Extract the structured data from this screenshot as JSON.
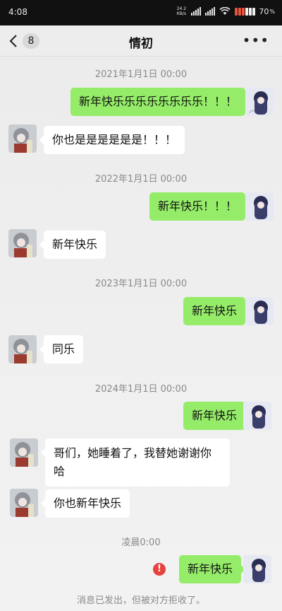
{
  "status": {
    "time": "4:08",
    "net_speed_value": "24.2",
    "net_speed_unit": "KB/s",
    "battery": "70"
  },
  "header": {
    "title": "情初",
    "unread_count": "8"
  },
  "messages": [
    {
      "timestamp": "2021年1月1日 00:00",
      "sent": "新年快乐乐乐乐乐乐乐乐！！！",
      "received": "你也是是是是是是！！！"
    },
    {
      "timestamp": "2022年1月1日 00:00",
      "sent": "新年快乐！！！",
      "received": "新年快乐"
    },
    {
      "timestamp": "2023年1月1日 00:00",
      "sent": "新年快乐",
      "received": "同乐"
    },
    {
      "timestamp": "2024年1月1日 00:00",
      "sent": "新年快乐",
      "received": "哥们，她睡着了，我替她谢谢你哈",
      "received2": "你也新年快乐"
    },
    {
      "timestamp": "凌晨0:00",
      "sent": "新年快乐"
    }
  ],
  "rejected_notice": "消息已发出，但被对方拒收了。",
  "colors": {
    "sent_bubble": "#95ec69",
    "error": "#e64340"
  }
}
